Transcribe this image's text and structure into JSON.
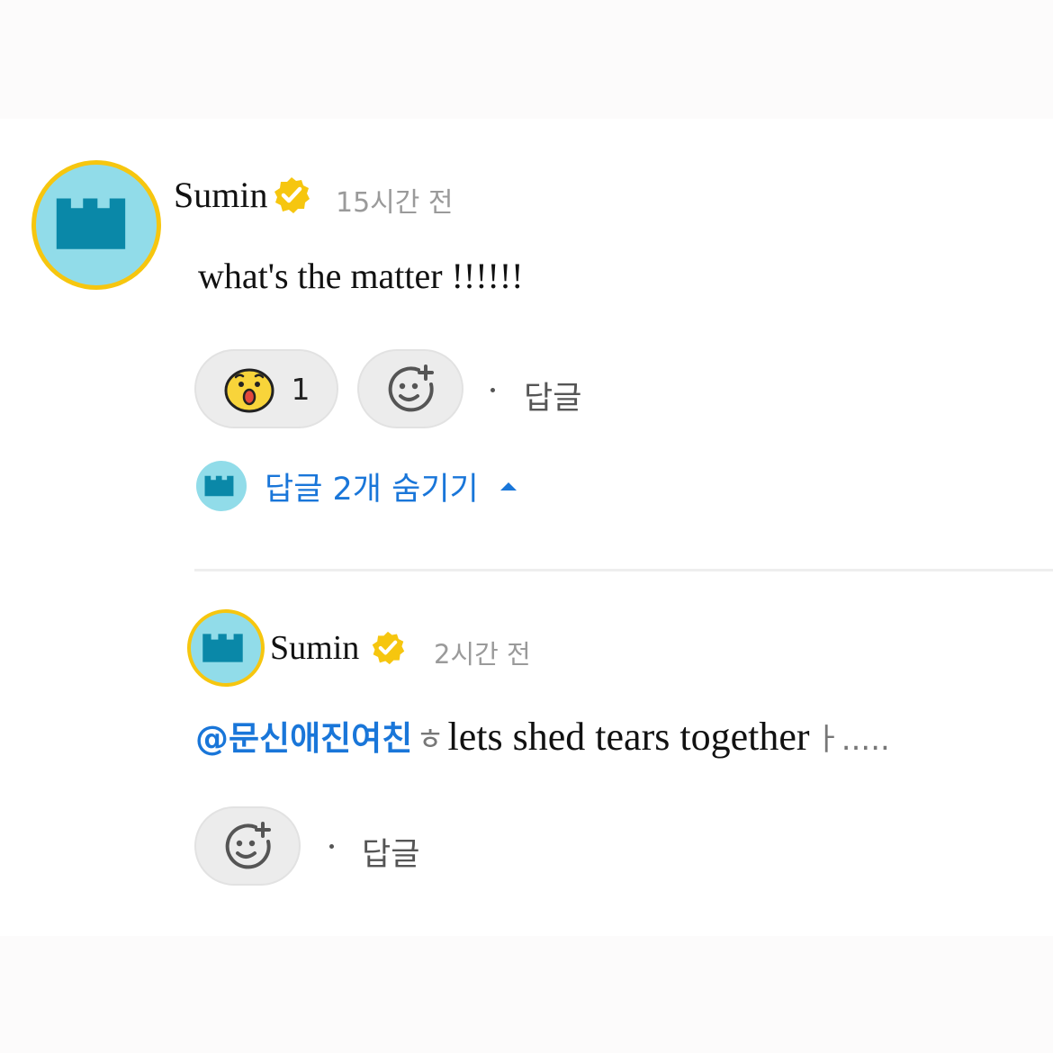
{
  "comment": {
    "author": "Sumin",
    "time": "15시간 전",
    "text": "what's the matter !!!!!!",
    "reaction_count": "1",
    "reply_label": "답글",
    "toggle_label": "답글 2개 숨기기"
  },
  "reply": {
    "author": "Sumin",
    "time": "2시간 전",
    "mention": "@문신애진여친",
    "frag_left": "ㅎ",
    "text": "lets shed tears together",
    "frag_right": "ㅏ.....",
    "reply_label": "답글"
  },
  "colors": {
    "badge": "#f6c60f",
    "link_blue": "#1976d9",
    "avatar_bg": "#91dce9",
    "avatar_castle": "#0a88a8",
    "avatar_ring": "#f6c60f"
  },
  "icons": {
    "verified": "verified-badge-icon",
    "reaction": "surprised-face-icon",
    "add_reaction": "add-reaction-smiley-icon",
    "caret": "caret-up-icon"
  }
}
